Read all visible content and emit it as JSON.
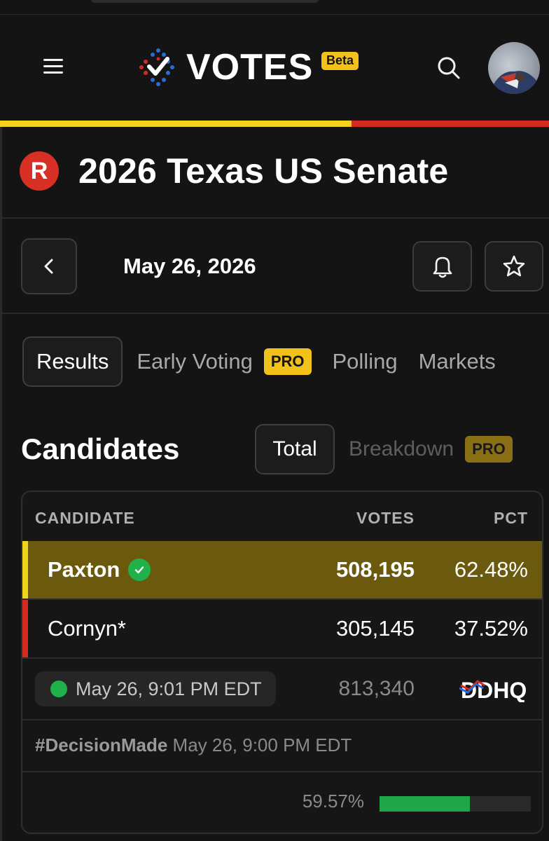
{
  "header": {
    "brand": "VOTES",
    "badge": "Beta",
    "menu_icon": "hamburger-menu-icon",
    "search_icon": "search-icon",
    "avatar_icon": "user-avatar"
  },
  "race": {
    "party_badge": "R",
    "party_color": "#d83024",
    "title": "2026 Texas US Senate"
  },
  "date_nav": {
    "date": "May 26, 2026",
    "prev_icon": "chevron-left-icon",
    "bell_icon": "bell-icon",
    "star_icon": "star-icon"
  },
  "tabs": [
    {
      "label": "Results",
      "active": true
    },
    {
      "label": "Early Voting",
      "badge": "PRO"
    },
    {
      "label": "Polling"
    },
    {
      "label": "Markets"
    }
  ],
  "candidates": {
    "heading": "Candidates",
    "toggle_total": "Total",
    "toggle_breakdown": "Breakdown",
    "breakdown_badge": "PRO",
    "columns": {
      "candidate": "CANDIDATE",
      "votes": "VOTES",
      "pct": "PCT"
    },
    "rows": [
      {
        "name": "Paxton",
        "votes": "508,195",
        "pct": "62.48%",
        "winner": true,
        "color": "#f2d51a"
      },
      {
        "name": "Cornyn*",
        "votes": "305,145",
        "pct": "37.52%",
        "winner": false,
        "color": "#d42a1f"
      }
    ],
    "updated": "May 26, 9:01 PM EDT",
    "total_votes": "813,340",
    "source": "DDHQ",
    "decision_tag": "#DecisionMade",
    "decision_time": "May 26, 9:00 PM EDT",
    "reporting_pct": "59.57%",
    "reporting_fraction": 0.5957
  },
  "colors": {
    "background": "#141414",
    "rep_yellow": "#f2d51a",
    "dem_red": "#d42a1f",
    "pro_badge": "#f2c21b",
    "winner_row": "#6b5a0d",
    "green": "#1fb14a"
  }
}
